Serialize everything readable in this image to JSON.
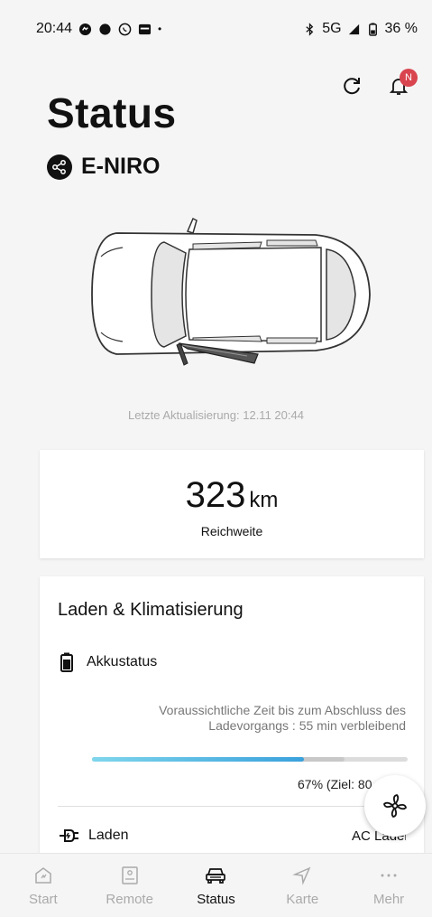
{
  "statusbar": {
    "time": "20:44",
    "network": "5G",
    "battery": "36 %"
  },
  "header": {
    "title": "Status",
    "vehicle_name": "E-NIRO",
    "notification_badge": "N"
  },
  "last_update": "Letzte Aktualisierung: 12.11 20:44",
  "range": {
    "value": "323",
    "unit": "km",
    "label": "Reichweite"
  },
  "charging": {
    "title": "Laden & Klimatisierung",
    "battery_label": "Akkustatus",
    "eta_text": "Voraussichtliche Zeit bis zum Abschluss des Ladevorgangs : 55 min verbleibend",
    "progress_fraction": 0.67,
    "target_fraction": 0.8,
    "percent_text": "67% (Ziel: 80",
    "laden_label": "Laden",
    "laden_value": "AC Laden"
  },
  "bottom_nav": {
    "items": [
      {
        "label": "Start",
        "icon": "home-icon"
      },
      {
        "label": "Remote",
        "icon": "remote-icon"
      },
      {
        "label": "Status",
        "icon": "car-icon"
      },
      {
        "label": "Karte",
        "icon": "navigation-icon"
      },
      {
        "label": "Mehr",
        "icon": "more-icon"
      }
    ],
    "active": "Status"
  },
  "colors": {
    "accent_blue": "#3aa1dc",
    "badge_red": "#d9454f"
  }
}
